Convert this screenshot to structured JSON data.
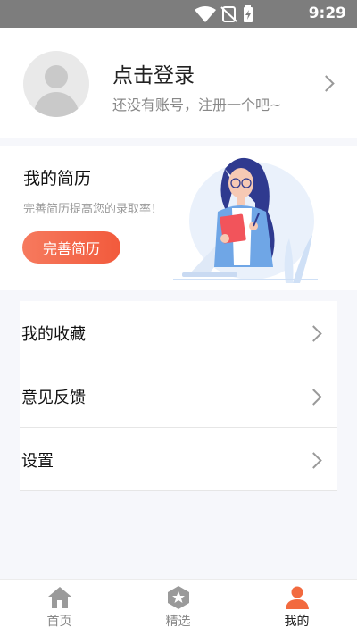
{
  "statusbar": {
    "time": "9:29",
    "icons": [
      "wifi-icon",
      "no-sim-icon",
      "battery-charging-icon"
    ]
  },
  "profile": {
    "title": "点击登录",
    "subtitle": "还没有账号，注册一个吧~",
    "avatar_icon": "default-avatar-icon",
    "chevron_icon": "chevron-right-icon"
  },
  "resume_card": {
    "title": "我的简历",
    "subtitle": "完善简历提高您的录取率！",
    "button_label": "完善简历",
    "button_colors": [
      "#f67a5e",
      "#f25a3c"
    ],
    "illustration": "woman-writing-illustration"
  },
  "menu": {
    "items": [
      {
        "label": "我的收藏",
        "icon": "chevron-right-icon"
      },
      {
        "label": "意见反馈",
        "icon": "chevron-right-icon"
      },
      {
        "label": "设置",
        "icon": "chevron-right-icon"
      }
    ]
  },
  "tabbar": {
    "accent_color": "#f26a3f",
    "inactive_color": "#888888",
    "tabs": [
      {
        "label": "首页",
        "icon": "home-icon",
        "active": false
      },
      {
        "label": "精选",
        "icon": "star-badge-icon",
        "active": false
      },
      {
        "label": "我的",
        "icon": "person-icon",
        "active": true
      }
    ]
  }
}
